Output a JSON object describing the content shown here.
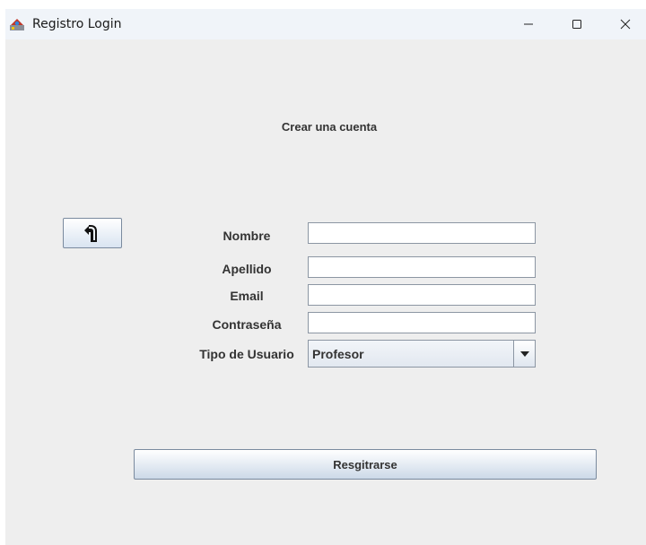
{
  "window": {
    "title": "Registro Login",
    "icon": "java-app-icon",
    "controls": [
      "minimize-icon",
      "maximize-icon",
      "close-icon"
    ]
  },
  "form": {
    "heading": "Crear una cuenta",
    "back_button_icon": "back-arrow-icon",
    "fields": [
      {
        "label": "Nombre",
        "value": ""
      },
      {
        "label": "Apellido",
        "value": ""
      },
      {
        "label": "Email",
        "value": ""
      },
      {
        "label": "Contraseña",
        "value": ""
      }
    ],
    "user_type": {
      "label": "Tipo de Usuario",
      "selected": "Profesor"
    },
    "submit_label": "Resgitrarse"
  }
}
